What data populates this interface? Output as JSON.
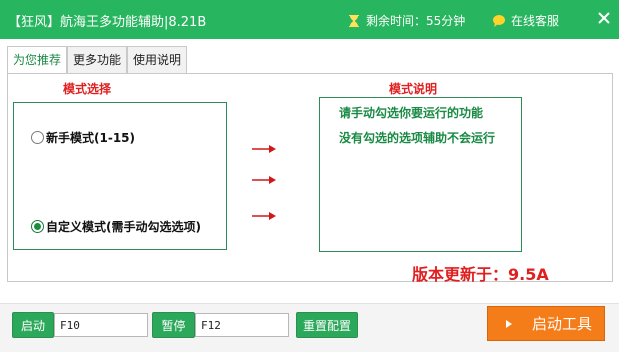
{
  "window": {
    "title": "【狂风】航海王多功能辅助|8.21B",
    "timer_label": "剩余时间：55分钟",
    "support_label": "在线客服"
  },
  "tabs": [
    {
      "label": "为您推荐",
      "active": true
    },
    {
      "label": "更多功能",
      "active": false
    },
    {
      "label": "使用说明",
      "active": false
    }
  ],
  "mode_select": {
    "heading": "模式选择",
    "options": [
      {
        "label": "新手模式(1-15)",
        "selected": false
      },
      {
        "label": "自定义模式(需手动勾选选项)",
        "selected": true
      }
    ]
  },
  "mode_desc": {
    "heading": "模式说明",
    "lines": [
      "请手动勾选你要运行的功能",
      "没有勾选的选项辅助不会运行"
    ]
  },
  "version_text": "版本更新于：9.5A",
  "bottom": {
    "start_label": "启动",
    "start_hotkey": "F10",
    "pause_label": "暂停",
    "pause_hotkey": "F12",
    "reset_label": "重置配置",
    "launch_label": "启动工具"
  },
  "colors": {
    "titlebar": "#28b55f",
    "accent_green": "#2ba85a",
    "red_text": "#e02020",
    "orange_button": "#f47d1a"
  },
  "icons": {
    "timer": "hourglass-icon",
    "support": "chat-bubble-icon",
    "close": "close-icon",
    "arrows": "right-arrow-icon",
    "launch": "play-icon"
  }
}
